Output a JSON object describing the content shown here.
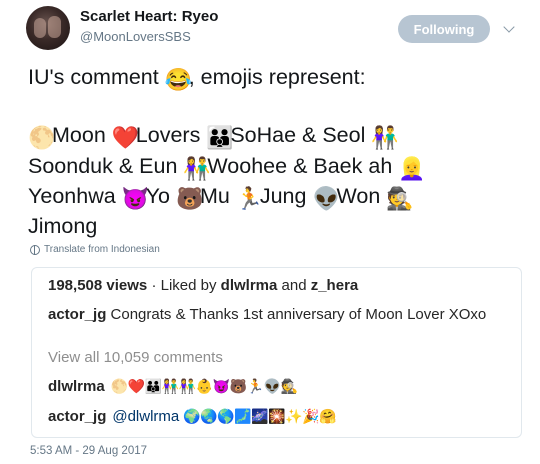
{
  "tweet": {
    "display_name": "Scarlet Heart: Ryeo",
    "handle": "@MoonLoversSBS",
    "follow_label": "Following",
    "line1_text": "IU's comment",
    "line1_emoji": "😂",
    "line1_rest": ", emojis represent:",
    "line2": [
      {
        "emoji": "🌕",
        "label": "Moon"
      },
      {
        "emoji": "❤️",
        "label": "Lovers"
      },
      {
        "emoji": "👪",
        "label": "SoHae & Seol"
      },
      {
        "emoji": "👫",
        "label": ""
      }
    ],
    "line3": [
      {
        "emoji": "",
        "label": "Soonduk & Eun"
      },
      {
        "emoji": "👫",
        "label": "Woohee & Baek ah"
      },
      {
        "emoji": "👱‍♀️",
        "label": ""
      }
    ],
    "line4": [
      {
        "emoji": "",
        "label": "Yeonhwa"
      },
      {
        "emoji": "😈",
        "label": "Yo"
      },
      {
        "emoji": "🐻",
        "label": "Mu"
      },
      {
        "emoji": "🏃",
        "label": "Jung"
      },
      {
        "emoji": "👽",
        "label": "Won"
      },
      {
        "emoji": "🕵️",
        "label": ""
      }
    ],
    "line5": "Jimong",
    "translate_label": "Translate from Indonesian",
    "timestamp": "5:53 AM - 29 Aug 2017"
  },
  "embedded": {
    "views_count": "198,508 views",
    "liked_by_prefix": "· Liked by",
    "liked_user1": "dlwlrma",
    "liked_and": "and",
    "liked_user2": "z_hera",
    "comment1_user": "actor_jg",
    "comment1_text": "Congrats & Thanks 1st anniversary of Moon Lover XOxo",
    "view_all": "View all 10,059 comments",
    "comment2_user": "dlwlrma",
    "comment2_emojis": [
      "🌕",
      "❤️",
      "👪",
      "👫",
      "👫",
      "👶",
      "😈",
      "🐻",
      "🏃",
      "👽",
      "🕵️"
    ],
    "comment3_user": "actor_jg",
    "comment3_mention": "@dlwlrma",
    "comment3_emojis": [
      "🌍",
      "🌏",
      "🌎",
      "🗾",
      "🌌",
      "🎇",
      "✨",
      "🎉",
      "🤗"
    ]
  }
}
